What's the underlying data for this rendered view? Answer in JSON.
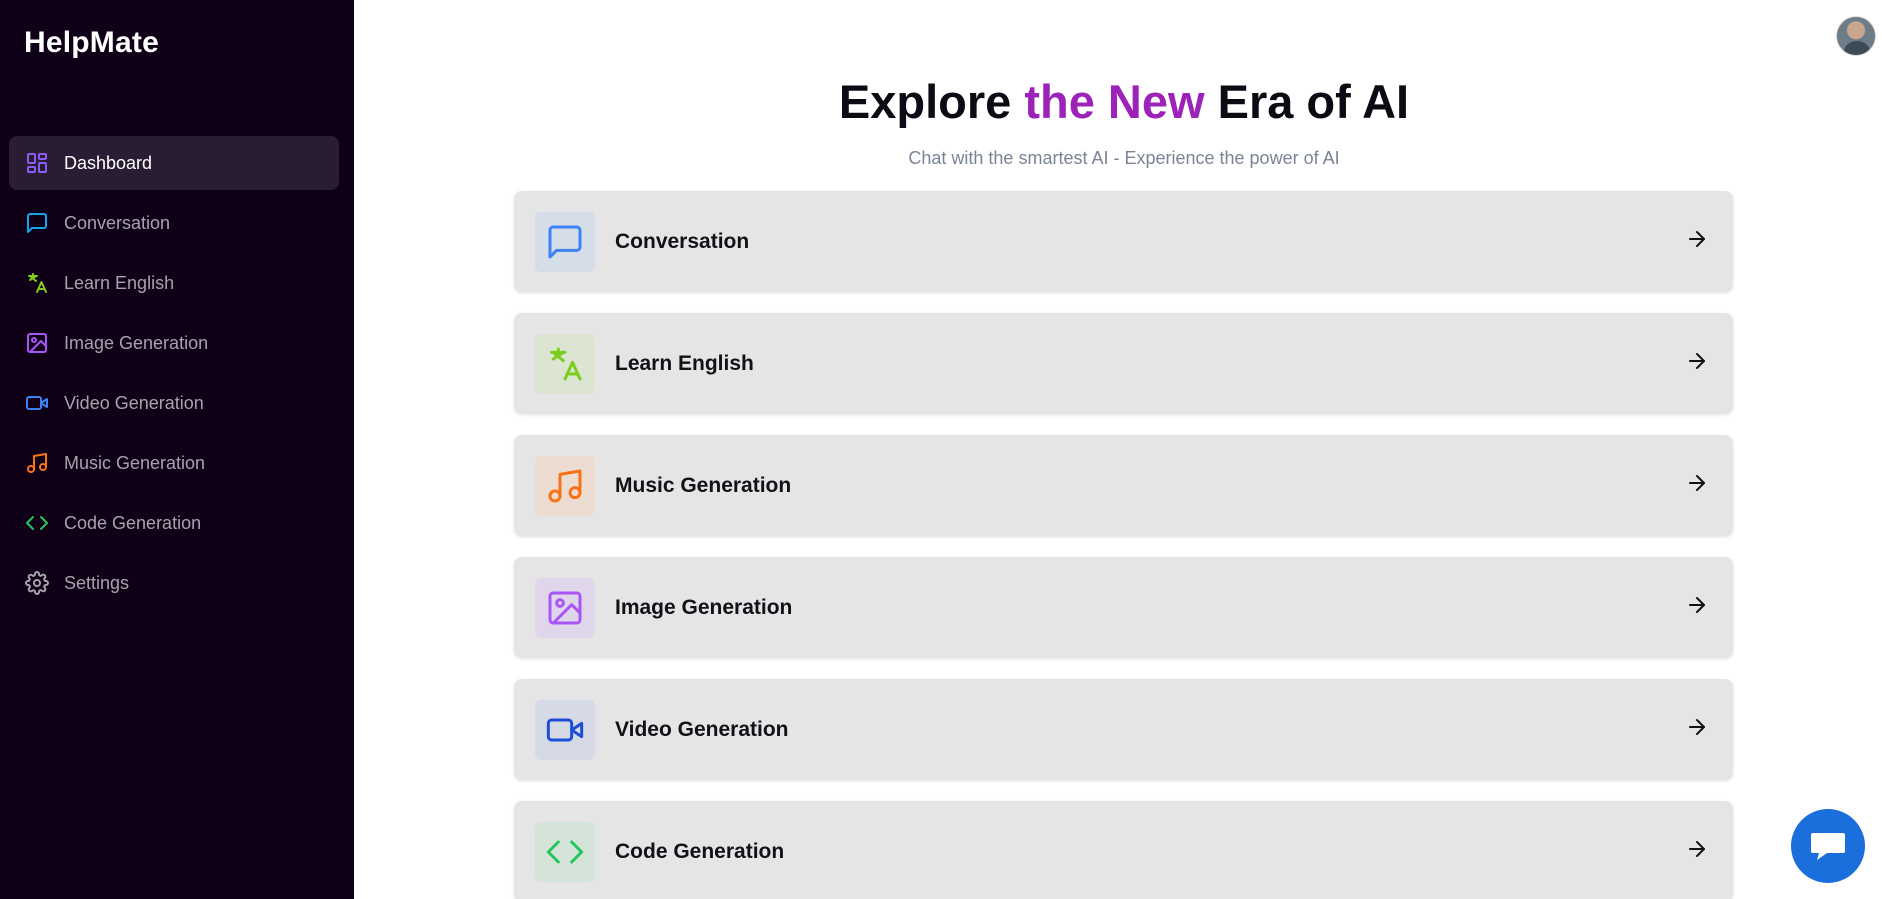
{
  "app": {
    "name": "HelpMate"
  },
  "sidebar": {
    "items": [
      {
        "label": "Dashboard",
        "icon": "dashboard-icon",
        "color": "#8b5cf6"
      },
      {
        "label": "Conversation",
        "icon": "chat-icon",
        "color": "#0ea5e9"
      },
      {
        "label": "Learn English",
        "icon": "translate-icon",
        "color": "#84cc16"
      },
      {
        "label": "Image Generation",
        "icon": "image-icon",
        "color": "#a855f7"
      },
      {
        "label": "Video Generation",
        "icon": "video-icon",
        "color": "#3b82f6"
      },
      {
        "label": "Music Generation",
        "icon": "music-icon",
        "color": "#f97316"
      },
      {
        "label": "Code Generation",
        "icon": "code-icon",
        "color": "#22c55e"
      },
      {
        "label": "Settings",
        "icon": "gear-icon",
        "color": "#a7a3ad"
      }
    ]
  },
  "hero": {
    "title_part1": "Explore ",
    "title_accent": "the New",
    "title_part2": " Era of AI",
    "subtitle": "Chat with the smartest AI - Experience the power of AI",
    "accent_color": "#9c22b8"
  },
  "cards": [
    {
      "label": "Conversation",
      "icon": "chat-icon",
      "color": "#3b82f6",
      "bg": "#d5dde9"
    },
    {
      "label": "Learn English",
      "icon": "translate-icon",
      "color": "#7ccc1c",
      "bg": "#dbe5d2"
    },
    {
      "label": "Music Generation",
      "icon": "music-icon",
      "color": "#f97316",
      "bg": "#ecdcd1"
    },
    {
      "label": "Image Generation",
      "icon": "image-icon",
      "color": "#a855f7",
      "bg": "#e0d6ec"
    },
    {
      "label": "Video Generation",
      "icon": "video-icon",
      "color": "#1d4ed8",
      "bg": "#d5dae6"
    },
    {
      "label": "Code Generation",
      "icon": "code-icon",
      "color": "#22c55e",
      "bg": "#d4e4d8"
    }
  ],
  "fab": {
    "icon": "chat-bubble-icon",
    "color": "#1b6fdc"
  }
}
